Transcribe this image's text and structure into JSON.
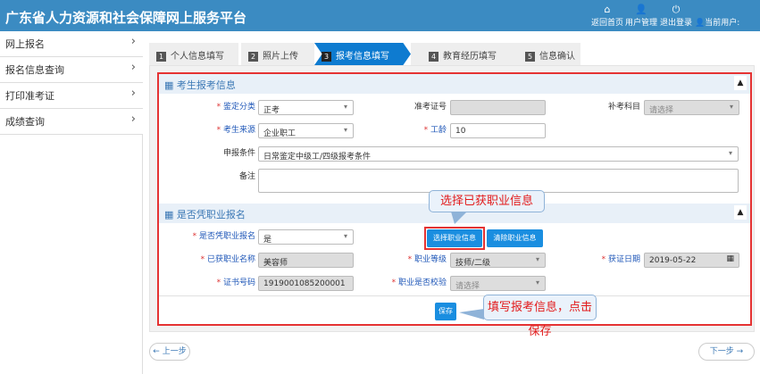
{
  "header": {
    "title": "广东省人力资源和社会保障网上服务平台",
    "home": "返回首页",
    "user_mgmt": "用户管理",
    "logout": "退出登录",
    "current_user": "当前用户:"
  },
  "sidebar": {
    "items": [
      {
        "label": "网上报名"
      },
      {
        "label": "报名信息查询"
      },
      {
        "label": "打印准考证"
      },
      {
        "label": "成绩查询"
      }
    ]
  },
  "steps": [
    {
      "num": "1",
      "label": "个人信息填写"
    },
    {
      "num": "2",
      "label": "照片上传"
    },
    {
      "num": "3",
      "label": "报考信息填写"
    },
    {
      "num": "4",
      "label": "教育经历填写"
    },
    {
      "num": "5",
      "label": "信息确认"
    }
  ],
  "active_step": 3,
  "section1": {
    "title": "考生报考信息",
    "jdfl": {
      "label": "鉴定分类",
      "value": "正考"
    },
    "zkzh": {
      "label": "准考证号",
      "value": ""
    },
    "bkkm": {
      "label": "补考科目",
      "placeholder": "请选择"
    },
    "kslx": {
      "label": "考生来源",
      "value": "企业职工"
    },
    "gl": {
      "label": "工龄",
      "value": "10"
    },
    "sbtj": {
      "label": "申报条件",
      "value": "日常鉴定中级工/四级报考条件"
    },
    "bz": {
      "label": "备注",
      "value": ""
    }
  },
  "section2": {
    "title": "是否凭职业报名",
    "sfpzy": {
      "label": "是否凭职业报名",
      "value": "是"
    },
    "select_btn": "选择职业信息",
    "clear_btn": "清除职业信息",
    "zymc": {
      "label": "已获职业名称",
      "value": "美容师"
    },
    "zydj": {
      "label": "职业等级",
      "value": "技师/二级"
    },
    "hzrq": {
      "label": "获证日期",
      "value": "2019-05-22"
    },
    "zsbh": {
      "label": "证书号码",
      "value": "1919001085200001"
    },
    "sfjy": {
      "label": "职业是否校验",
      "placeholder": "请选择"
    }
  },
  "save": "保存",
  "callouts": {
    "select": "选择已获职业信息",
    "save": "填写报考信息，点击保存"
  },
  "nav": {
    "prev": "← 上一步",
    "next": "下一步 →"
  },
  "colors": {
    "header": "#3b8bc2",
    "active_step": "#0e7bd0",
    "button": "#1a8ee0",
    "highlight": "#e53333"
  }
}
